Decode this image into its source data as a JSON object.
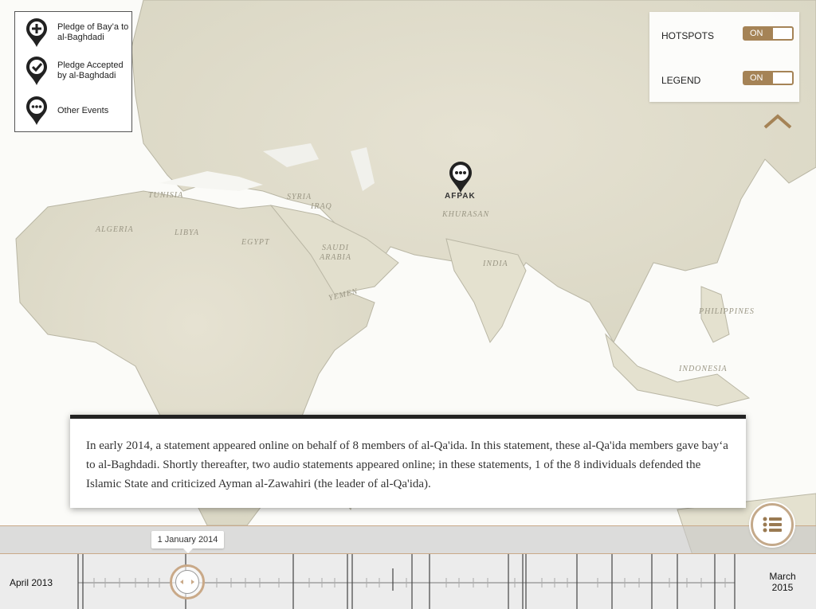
{
  "map": {
    "region_labels": [
      "TUNISIA",
      "ALGERIA",
      "LIBYA",
      "EGYPT",
      "SYRIA",
      "IRAQ",
      "SAUDI ARABIA",
      "YEMEN",
      "AFPAK",
      "KHURASAN",
      "INDIA",
      "PHILIPPINES",
      "INDONESIA"
    ],
    "marker": {
      "label": "AFPAK",
      "icon": "other-events-pin-icon"
    }
  },
  "legend": {
    "items": [
      {
        "icon": "pin-plus-icon",
        "label": "Pledge of Bay’a to al-Baghdadi"
      },
      {
        "icon": "pin-check-icon",
        "label": "Pledge Accepted by al-Baghdadi"
      },
      {
        "icon": "pin-ellipsis-icon",
        "label": "Other Events"
      }
    ]
  },
  "controls": {
    "hotspots": {
      "label": "HOTSPOTS",
      "state": "ON"
    },
    "legend": {
      "label": "LEGEND",
      "state": "ON"
    },
    "accent": "#a58356"
  },
  "info": {
    "text": "In early 2014, a statement appeared online on behalf of 8 members of al-Qa'ida. In this statement, these al-Qa'ida members gave bay‘a to al-Baghdadi. Shortly thereafter, two audio statements appeared online; in these statements, 1 of the 8 individuals defended the Islamic State and criticized Ayman al-Zawahiri (the leader of al-Qa'ida)."
  },
  "timeline": {
    "start_label": "April 2013",
    "end_label_month": "March",
    "end_label_year": "2015",
    "current_date": "1 January 2014"
  }
}
